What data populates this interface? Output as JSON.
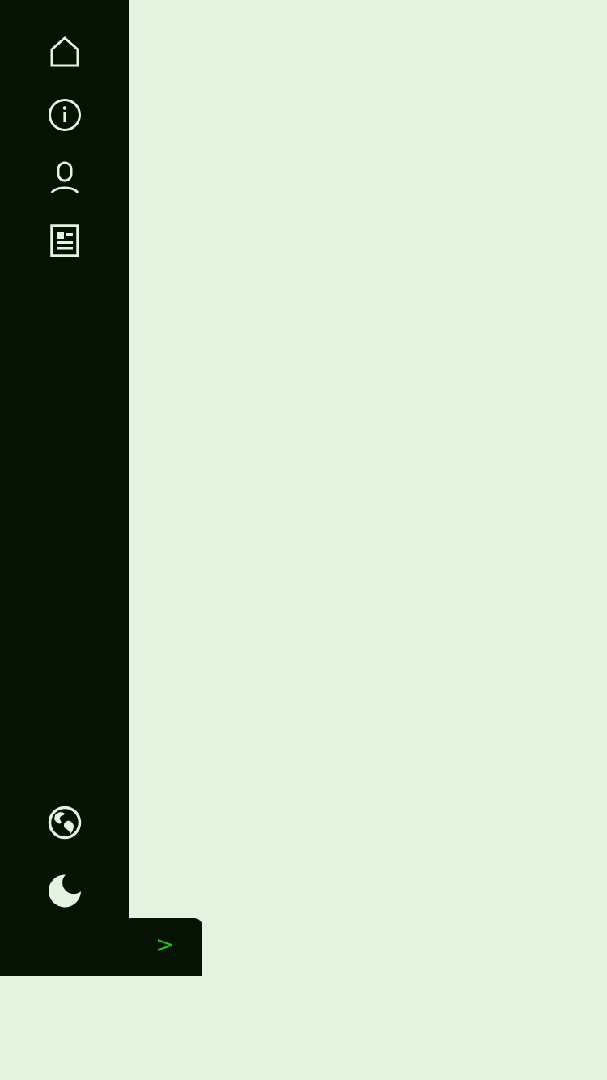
{
  "sidebar": {
    "background": "#051204",
    "icon_color": "#e5f4e1",
    "nav_items": [
      {
        "name": "home",
        "icon": "home-icon"
      },
      {
        "name": "about",
        "icon": "info-icon"
      },
      {
        "name": "profile",
        "icon": "user-icon"
      },
      {
        "name": "articles",
        "icon": "newspaper-icon"
      }
    ],
    "bottom_items": [
      {
        "name": "language",
        "icon": "globe-icon"
      },
      {
        "name": "theme",
        "icon": "moon-icon"
      }
    ]
  },
  "toggle": {
    "icon": "chevron-right-icon",
    "label": ">",
    "accent": "#1fc21f"
  },
  "main": {
    "background": "#e5f4e1"
  }
}
